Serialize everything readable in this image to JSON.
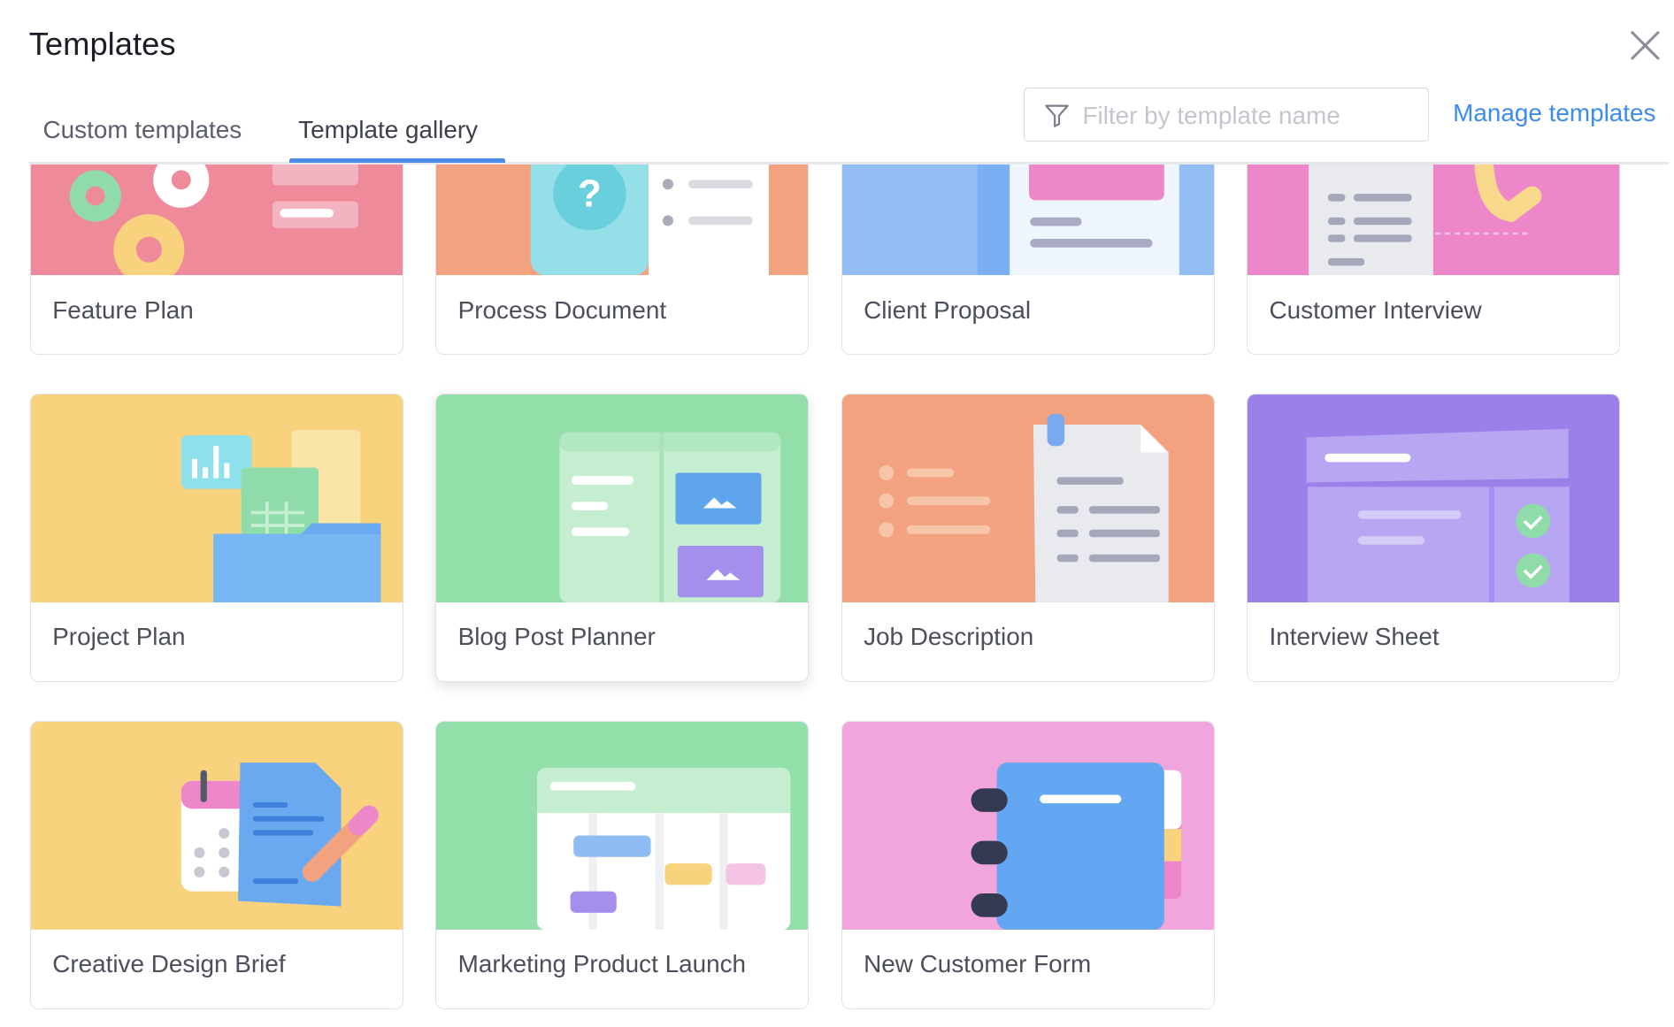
{
  "header": {
    "title": "Templates",
    "close_icon": "close-icon"
  },
  "tabs": [
    {
      "label": "Custom templates",
      "active": false
    },
    {
      "label": "Template gallery",
      "active": true
    }
  ],
  "filter": {
    "placeholder": "Filter by template name",
    "value": "",
    "icon": "filter-icon"
  },
  "manage_label": "Manage templates",
  "colors": {
    "accent": "#4a8be8",
    "link": "#3d8bef"
  },
  "templates": [
    {
      "name": "Feature Plan",
      "bg": "#ef8a9b"
    },
    {
      "name": "Process Document",
      "bg": "#f2a27e"
    },
    {
      "name": "Client Proposal",
      "bg": "#93bdf3"
    },
    {
      "name": "Customer Interview",
      "bg": "#ee87c9"
    },
    {
      "name": "Project Plan",
      "bg": "#f8d27c"
    },
    {
      "name": "Blog Post Planner",
      "bg": "#93dfa9"
    },
    {
      "name": "Job Description",
      "bg": "#f2a27e"
    },
    {
      "name": "Interview Sheet",
      "bg": "#9b80ea"
    },
    {
      "name": "Creative Design Brief",
      "bg": "#f8d27c"
    },
    {
      "name": "Marketing Product Launch",
      "bg": "#93dfa9"
    },
    {
      "name": "New Customer Form",
      "bg": "#f0a5dc"
    }
  ]
}
